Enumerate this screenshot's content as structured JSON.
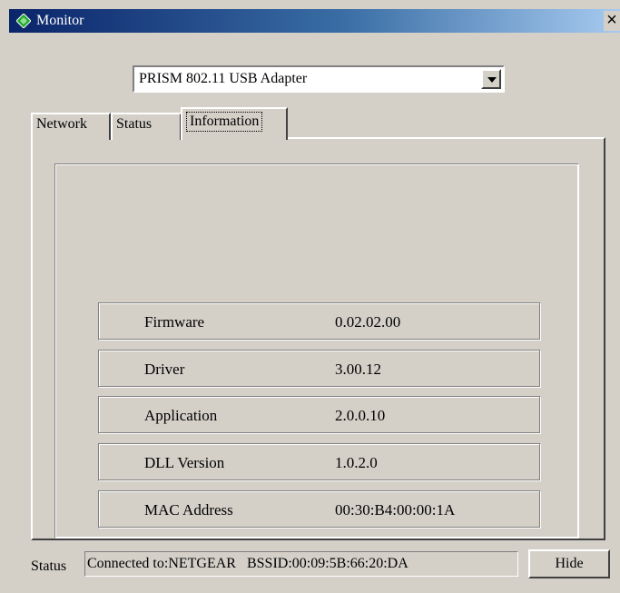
{
  "window": {
    "title": "Monitor",
    "close_glyph": "×"
  },
  "adapter": {
    "selected": "PRISM 802.11 USB Adapter"
  },
  "tabs": [
    {
      "label": "Network",
      "active": false
    },
    {
      "label": "Status",
      "active": false
    },
    {
      "label": "Information",
      "active": true
    }
  ],
  "information": {
    "rows": [
      {
        "label": "Firmware",
        "value": "0.02.02.00"
      },
      {
        "label": "Driver",
        "value": "3.00.12"
      },
      {
        "label": "Application",
        "value": "2.0.0.10"
      },
      {
        "label": "DLL Version",
        "value": "1.0.2.0"
      },
      {
        "label": "MAC Address",
        "value": "00:30:B4:00:00:1A"
      }
    ]
  },
  "statusbar": {
    "label": "Status",
    "text": "Connected to:NETGEAR   BSSID:00:09:5B:66:20:DA",
    "hide_label": "Hide"
  },
  "colors": {
    "titlebar_start": "#0a246a",
    "titlebar_end": "#a6caf0",
    "face": "#d4d0c8",
    "icon_green": "#1fa82f"
  },
  "icons": {
    "title": "app-diamond-icon",
    "close": "close-icon",
    "dropdown": "chevron-down-icon"
  }
}
